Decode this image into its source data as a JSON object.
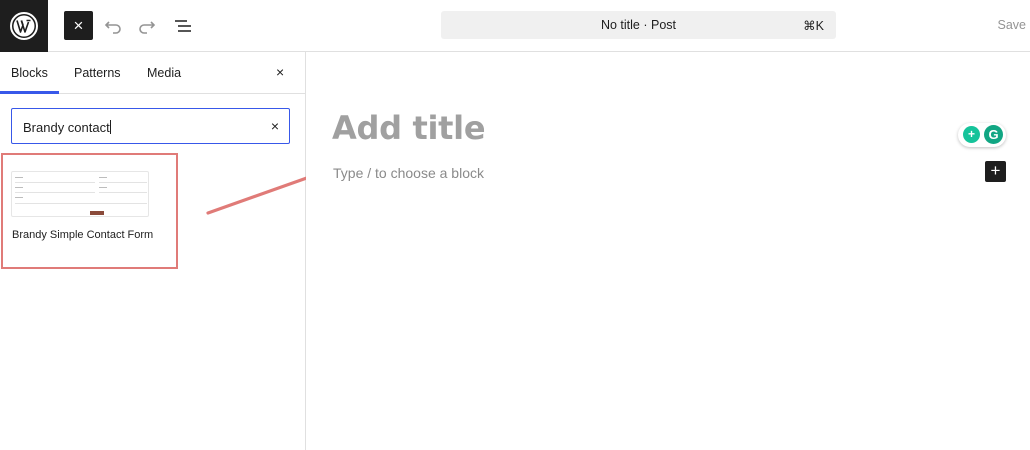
{
  "toolbar": {
    "close_icon": "×",
    "undo_icon": "undo-arrow",
    "redo_icon": "redo-arrow",
    "document_overview_icon": "list-view",
    "command_title": "No title · Post",
    "command_shortcut": "⌘K",
    "save_label": "Save"
  },
  "inserter": {
    "tabs": [
      {
        "label": "Blocks"
      },
      {
        "label": "Patterns"
      },
      {
        "label": "Media"
      }
    ],
    "close_icon": "×",
    "search": {
      "value": "Brandy contact",
      "clear_icon": "×"
    },
    "results": [
      {
        "label": "Brandy Simple Contact Form"
      }
    ]
  },
  "editor": {
    "title_placeholder": "Add title",
    "block_placeholder": "Type / to choose a block",
    "add_block_icon": "+",
    "grammarly_letter": "G"
  },
  "colors": {
    "accent": "#3858e9",
    "annotation": "#e07b78",
    "dark": "#1e1e1e"
  }
}
